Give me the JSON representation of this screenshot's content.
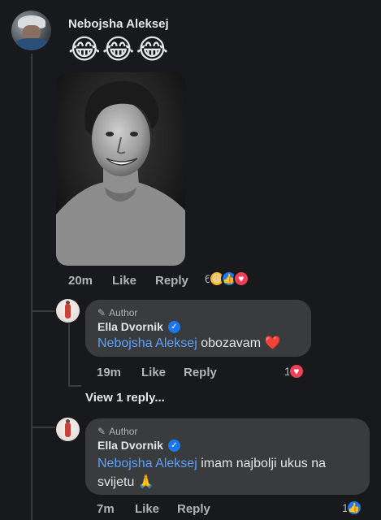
{
  "post": {
    "author_name": "Nebojsha Aleksej",
    "emoji_text": "😂😂😂",
    "time": "20m",
    "like_label": "Like",
    "reply_label": "Reply",
    "reaction_count": "6"
  },
  "replies_link": "View 1 reply...",
  "replies": [
    {
      "badge": "Author",
      "author_name": "Ella Dvornik",
      "mention": "Nebojsha Aleksej",
      "text_line1": " obozavam ❤️",
      "text_line2": "",
      "time": "19m",
      "like_label": "Like",
      "reply_label": "Reply",
      "reaction_count": "1"
    },
    {
      "badge": "Author",
      "author_name": "Ella Dvornik",
      "mention": "Nebojsha Aleksej",
      "text_line1": " imam najbolji ukus na",
      "text_line2": "svijetu 🙏",
      "time": "7m",
      "like_label": "Like",
      "reply_label": "Reply",
      "reaction_count": "1"
    }
  ],
  "colors": {
    "background": "#18191a",
    "bubble": "#3a3b3c",
    "mention": "#5aa0ff",
    "like_blue": "#1877f2",
    "love_red": "#f33e58"
  }
}
